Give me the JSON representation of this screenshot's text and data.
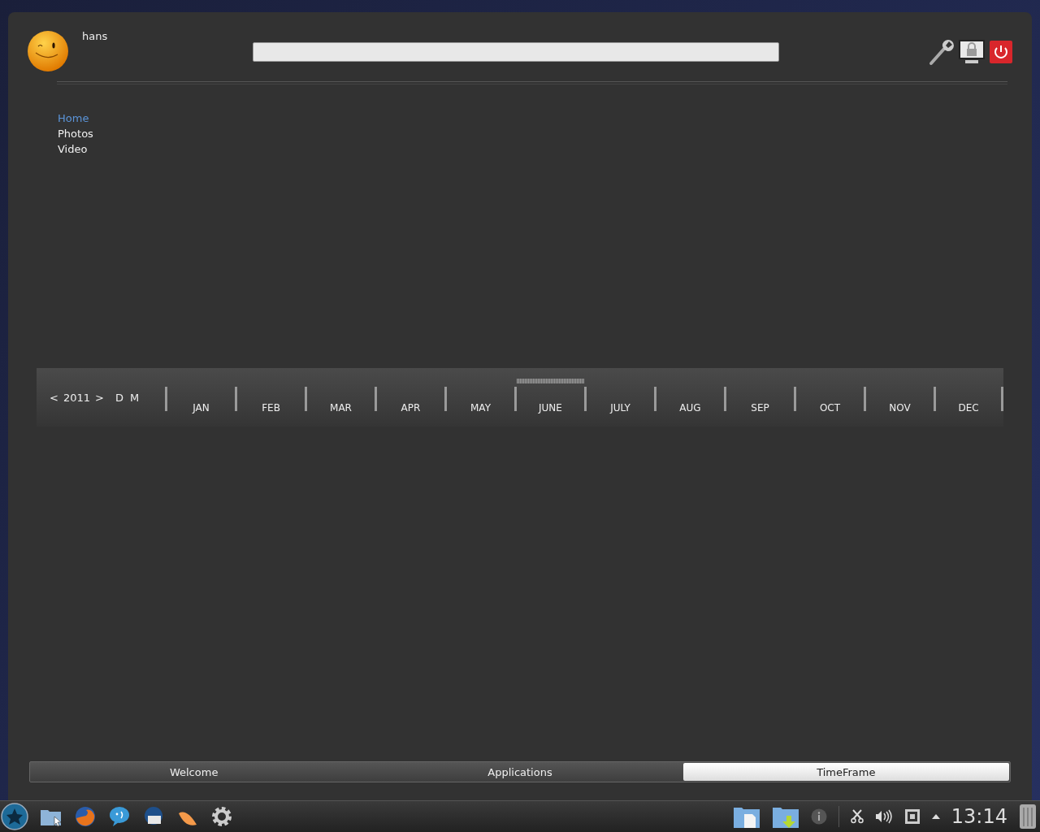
{
  "user": {
    "name": "hans"
  },
  "nav": [
    {
      "label": "Home",
      "selected": true
    },
    {
      "label": "Photos",
      "selected": false
    },
    {
      "label": "Video",
      "selected": false
    }
  ],
  "timeline": {
    "prev": "<",
    "year": "2011",
    "next": ">",
    "day_button": "D",
    "month_button": "M",
    "months": [
      {
        "label": "JAN",
        "has_items": false
      },
      {
        "label": "FEB",
        "has_items": false
      },
      {
        "label": "MAR",
        "has_items": false
      },
      {
        "label": "APR",
        "has_items": false
      },
      {
        "label": "MAY",
        "has_items": false
      },
      {
        "label": "JUNE",
        "has_items": true
      },
      {
        "label": "JULY",
        "has_items": false
      },
      {
        "label": "AUG",
        "has_items": false
      },
      {
        "label": "SEP",
        "has_items": false
      },
      {
        "label": "OCT",
        "has_items": false
      },
      {
        "label": "NOV",
        "has_items": false
      },
      {
        "label": "DEC",
        "has_items": false
      }
    ]
  },
  "tabs": [
    {
      "label": "Welcome",
      "selected": false
    },
    {
      "label": "Applications",
      "selected": false
    },
    {
      "label": "TimeFrame",
      "selected": true
    }
  ],
  "taskbar": {
    "clock": "13:14"
  }
}
